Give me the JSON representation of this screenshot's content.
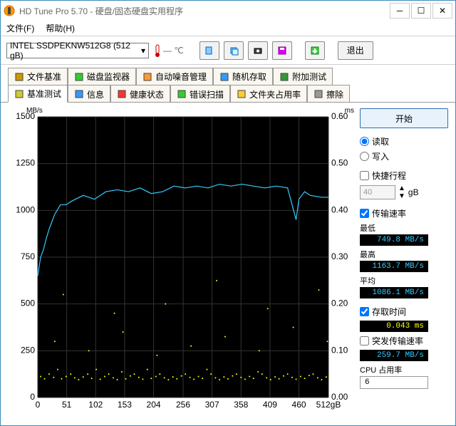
{
  "window": {
    "title": "HD Tune Pro 5.70 - 硬盘/固态硬盘实用程序"
  },
  "menu": {
    "file": "文件(F)",
    "help": "帮助(H)"
  },
  "toolbar": {
    "device": "INTEL SSDPEKNW512G8 (512 gB)",
    "temp": "— ℃",
    "exit": "退出"
  },
  "tabs": {
    "row1": [
      {
        "label": "文件基准",
        "icon": "ruler"
      },
      {
        "label": "磁盘监视器",
        "icon": "monitor"
      },
      {
        "label": "自动噪音管理",
        "icon": "speaker"
      },
      {
        "label": "随机存取",
        "icon": "dice"
      },
      {
        "label": "附加测试",
        "icon": "plus"
      }
    ],
    "row2": [
      {
        "label": "基准测试",
        "icon": "bench",
        "active": true
      },
      {
        "label": "信息",
        "icon": "info"
      },
      {
        "label": "健康状态",
        "icon": "health"
      },
      {
        "label": "错误扫描",
        "icon": "scan"
      },
      {
        "label": "文件夹占用率",
        "icon": "folder"
      },
      {
        "label": "擦除",
        "icon": "erase"
      }
    ]
  },
  "side": {
    "start": "开始",
    "read": "读取",
    "write": "写入",
    "short": "快捷行程",
    "short_val": "40",
    "short_unit": "gB",
    "tr": "传输速率",
    "min_lbl": "最低",
    "min": "749.8 MB/s",
    "max_lbl": "最高",
    "max": "1163.7 MB/s",
    "avg_lbl": "平均",
    "avg": "1086.1 MB/s",
    "acc_lbl": "存取时间",
    "acc": "0.043 ms",
    "burst_lbl": "突发传输速率",
    "burst": "259.7 MB/s",
    "cpu_lbl": "CPU 占用率",
    "cpu": "6"
  },
  "chart_data": {
    "type": "line",
    "title": "",
    "xlabel": "gB",
    "ylabel": "MB/s",
    "y2label": "ms",
    "xlim": [
      0,
      512
    ],
    "ylim": [
      0,
      1500
    ],
    "y2lim": [
      0,
      0.6
    ],
    "categories": [
      0,
      51,
      102,
      153,
      204,
      256,
      307,
      358,
      409,
      460,
      "512gB"
    ],
    "yticks": [
      0,
      250,
      500,
      750,
      1000,
      1250,
      1500
    ],
    "y2ticks": [
      0,
      0.1,
      0.2,
      0.3,
      0.4,
      0.5,
      0.6
    ],
    "series": [
      {
        "name": "Transfer rate (MB/s)",
        "color": "#3cf",
        "axis": "left",
        "x": [
          0,
          5,
          10,
          15,
          20,
          30,
          40,
          50,
          60,
          80,
          100,
          120,
          140,
          160,
          180,
          200,
          220,
          240,
          260,
          280,
          300,
          320,
          340,
          360,
          380,
          400,
          420,
          440,
          455,
          460,
          470,
          480,
          500,
          512
        ],
        "values": [
          650,
          750,
          790,
          850,
          900,
          980,
          1030,
          1030,
          1050,
          1080,
          1060,
          1100,
          1110,
          1100,
          1120,
          1090,
          1100,
          1130,
          1120,
          1130,
          1120,
          1140,
          1130,
          1140,
          1130,
          1120,
          1130,
          1120,
          950,
          1060,
          1100,
          1080,
          1070,
          1070
        ]
      },
      {
        "name": "Access time (ms)",
        "color": "#ff0",
        "axis": "right",
        "type": "scatter",
        "x": [
          5,
          12,
          20,
          28,
          35,
          42,
          50,
          58,
          65,
          72,
          80,
          88,
          95,
          103,
          110,
          118,
          125,
          133,
          140,
          148,
          155,
          163,
          170,
          178,
          185,
          193,
          200,
          208,
          215,
          223,
          230,
          238,
          245,
          253,
          260,
          268,
          275,
          283,
          290,
          298,
          305,
          313,
          320,
          328,
          335,
          343,
          350,
          358,
          365,
          373,
          380,
          388,
          395,
          403,
          410,
          418,
          425,
          433,
          440,
          448,
          455,
          463,
          470,
          478,
          485,
          493,
          500,
          508,
          30,
          90,
          150,
          210,
          270,
          330,
          390,
          450,
          510,
          45,
          135,
          225,
          315,
          405,
          495
        ],
        "values": [
          0.045,
          0.04,
          0.05,
          0.043,
          0.06,
          0.04,
          0.045,
          0.05,
          0.042,
          0.038,
          0.044,
          0.05,
          0.041,
          0.06,
          0.039,
          0.045,
          0.05,
          0.042,
          0.038,
          0.055,
          0.04,
          0.046,
          0.05,
          0.043,
          0.039,
          0.06,
          0.041,
          0.045,
          0.05,
          0.042,
          0.038,
          0.044,
          0.04,
          0.046,
          0.05,
          0.043,
          0.039,
          0.045,
          0.041,
          0.06,
          0.05,
          0.042,
          0.038,
          0.044,
          0.04,
          0.046,
          0.05,
          0.043,
          0.039,
          0.045,
          0.041,
          0.055,
          0.05,
          0.042,
          0.038,
          0.044,
          0.04,
          0.046,
          0.05,
          0.043,
          0.039,
          0.045,
          0.041,
          0.047,
          0.05,
          0.042,
          0.038,
          0.044,
          0.12,
          0.1,
          0.14,
          0.09,
          0.11,
          0.13,
          0.1,
          0.15,
          0.12,
          0.22,
          0.18,
          0.2,
          0.25,
          0.19,
          0.23
        ]
      }
    ]
  }
}
